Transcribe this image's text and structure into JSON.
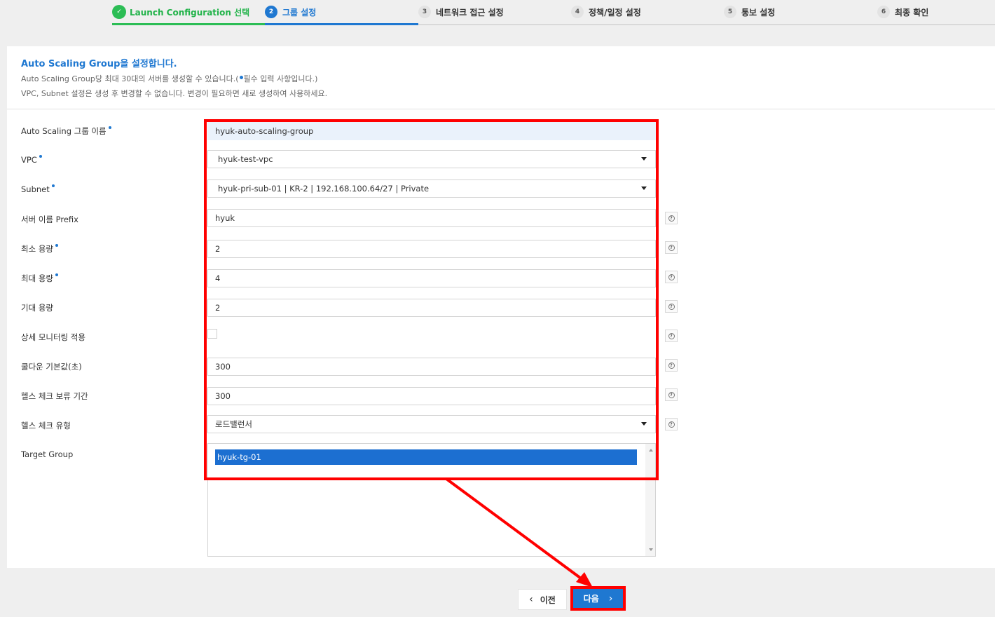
{
  "stepper": {
    "steps": [
      {
        "num": "✓",
        "label": "Launch Configuration 선택",
        "state": "done"
      },
      {
        "num": "2",
        "label": "그룹 설정",
        "state": "active"
      },
      {
        "num": "3",
        "label": "네트워크 접근 설정",
        "state": "pending"
      },
      {
        "num": "4",
        "label": "정책/일정 설정",
        "state": "pending"
      },
      {
        "num": "5",
        "label": "통보 설정",
        "state": "pending"
      },
      {
        "num": "6",
        "label": "최종 확인",
        "state": "pending"
      }
    ]
  },
  "header": {
    "title": "Auto Scaling Group을 설정합니다.",
    "desc1_before": "Auto Scaling Group당 최대 30대의 서버를 생성할 수 있습니다.(",
    "desc1_after": "필수 입력 사항입니다.)",
    "desc2": "VPC, Subnet 설정은 생성 후 변경할 수 없습니다. 변경이 필요하면 새로 생성하여 사용하세요."
  },
  "form": {
    "name_label": "Auto Scaling 그룹 이름",
    "name_value": "hyuk-auto-scaling-group",
    "vpc_label": "VPC",
    "vpc_value": "hyuk-test-vpc",
    "subnet_label": "Subnet",
    "subnet_value": "hyuk-pri-sub-01 | KR-2 | 192.168.100.64/27 | Private",
    "prefix_label": "서버 이름 Prefix",
    "prefix_value": "hyuk",
    "min_label": "최소 용량",
    "min_value": "2",
    "max_label": "최대 용량",
    "max_value": "4",
    "desired_label": "기대 용량",
    "desired_value": "2",
    "monitoring_label": "상세 모니터링 적용",
    "monitoring_checked": false,
    "cooldown_label": "쿨다운 기본값(초)",
    "cooldown_value": "300",
    "grace_label": "헬스 체크 보류 기간",
    "grace_value": "300",
    "healthcheck_label": "헬스 체크 유형",
    "healthcheck_value": "로드밸런서",
    "target_label": "Target Group",
    "target_options": [
      "hyuk-tg-01"
    ]
  },
  "footer": {
    "prev_label": "이전",
    "next_label": "다음"
  },
  "colors": {
    "accent": "#1f78d1",
    "done": "#2cbd55",
    "annotation": "#ff0000"
  }
}
